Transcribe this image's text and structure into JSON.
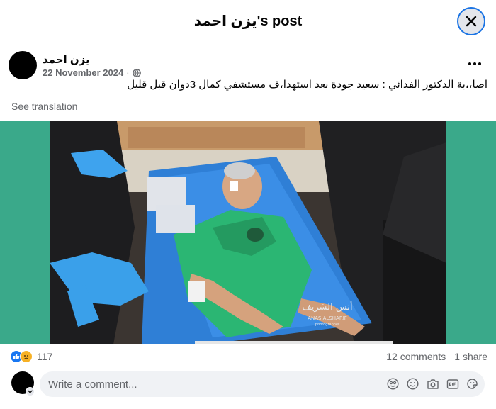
{
  "header": {
    "title": "يزن احمد's post"
  },
  "post": {
    "author": "يزن احمد",
    "date": "22 November 2024",
    "separator": "·",
    "text": "اصا،،بة الدكتور الفدائي : سعيد جودة بعد استهدا،ف مستشفي كمال 3دوان قبل قليل",
    "see_translation": "See translation",
    "watermark_line1": "أنس الشريف",
    "watermark_line2": "ANAS ALSHARIF",
    "watermark_line3": "photographer"
  },
  "stats": {
    "reaction_count": "117",
    "comments": "12 comments",
    "shares": "1 share"
  },
  "comment_box": {
    "placeholder": "Write a comment..."
  },
  "icons": [
    "close-icon",
    "more-icon",
    "globe-icon",
    "like-icon",
    "sad-icon",
    "avatar-chevron-icon",
    "avatar-icon",
    "emoji-icon",
    "camera-icon",
    "gif-icon",
    "sticker-icon"
  ],
  "colors": {
    "accent": "#1877f2",
    "focus_ring": "#1b74e4",
    "media_background": "#3aa98a",
    "secondary_text": "#65676b"
  }
}
